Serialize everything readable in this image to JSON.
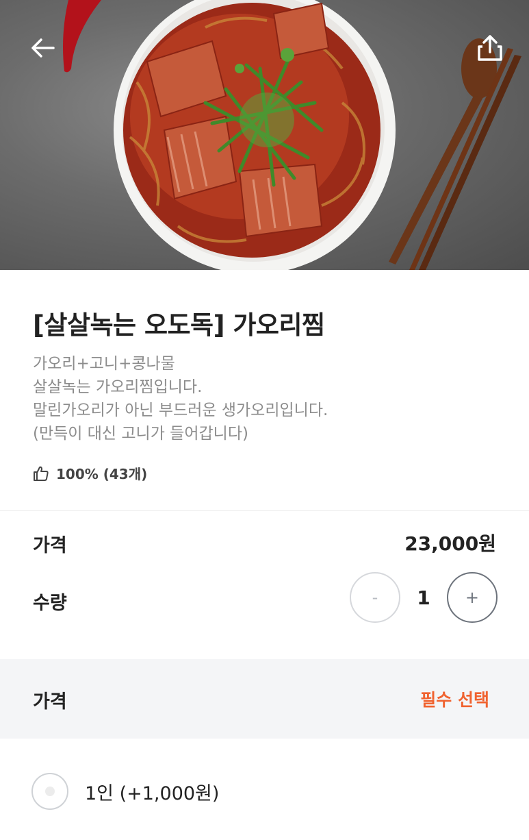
{
  "colors": {
    "accent": "#f0622f",
    "text_primary": "#222222",
    "text_secondary": "#8c8c8c",
    "section_bg": "#f4f5f7"
  },
  "header": {
    "back_icon": "arrow-left-icon",
    "share_icon": "share-icon"
  },
  "product": {
    "title": "[살살녹는 오도독] 가오리찜",
    "description": [
      "가오리+고니+콩나물",
      "살살녹는 가오리찜입니다.",
      "말린가오리가 아닌 부드러운 생가오리입니다.",
      "(만득이 대신 고니가 들어갑니다)"
    ],
    "rating_icon": "thumbs-up-icon",
    "rating": "100% (43개)"
  },
  "order": {
    "price_label": "가격",
    "price_value": "23,000원",
    "quantity_label": "수량",
    "quantity": "1",
    "minus_label": "-",
    "plus_label": "+"
  },
  "options": {
    "section_title": "가격",
    "required_label": "필수 선택",
    "items": [
      {
        "label": "1인 (+1,000원)",
        "selected": false
      }
    ]
  }
}
